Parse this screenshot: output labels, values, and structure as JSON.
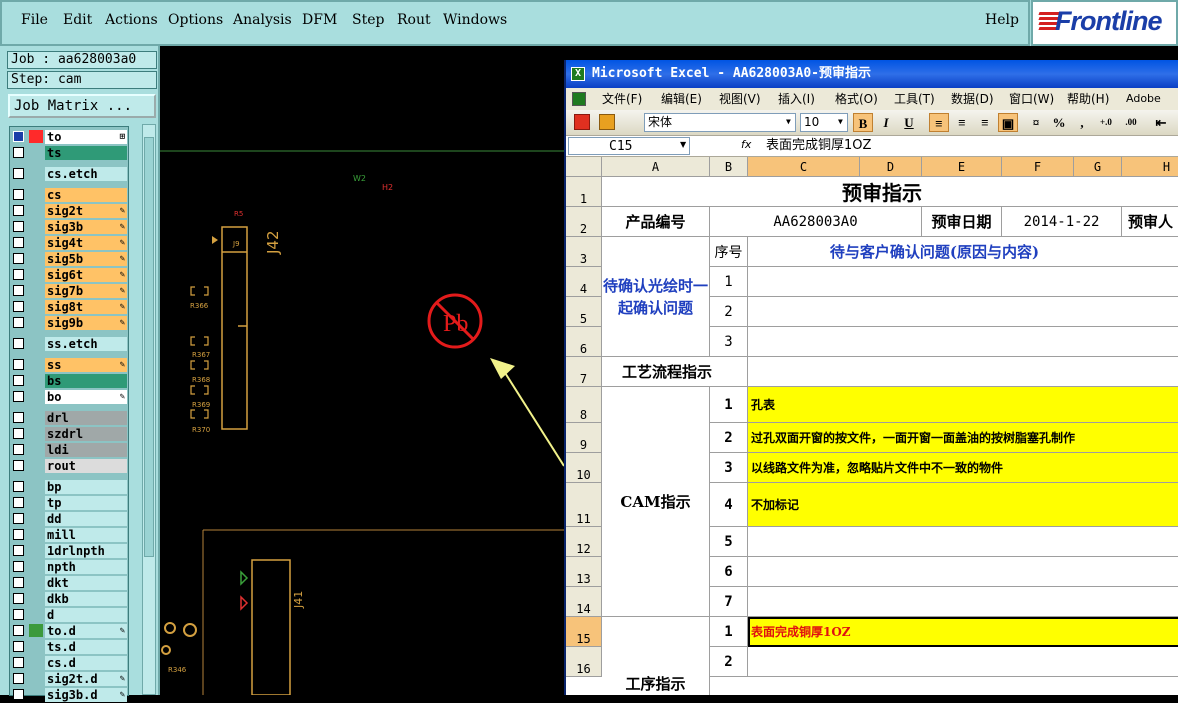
{
  "menubar": {
    "items": [
      "File",
      "Edit",
      "Actions",
      "Options",
      "Analysis",
      "DFM",
      "Step",
      "Rout",
      "Windows"
    ],
    "help": "Help",
    "logo": "Frontline"
  },
  "job": {
    "job_label": "Job : aa628003a0",
    "step_label": "Step: cam",
    "matrix_button": "Job Matrix ..."
  },
  "layers": [
    {
      "name": "to",
      "color": "#ffffff",
      "swatch": "#ff2a2a",
      "check": "blue",
      "icon": "⊞"
    },
    {
      "name": "ts",
      "color": "#2f9a77",
      "swatch": "",
      "check": "",
      "icon": ""
    },
    {
      "name": "cs.etch",
      "color": "#bfeaea",
      "swatch": "",
      "check": "",
      "icon": "",
      "gap": true
    },
    {
      "name": "cs",
      "color": "#ffc266",
      "swatch": "",
      "check": "",
      "icon": "",
      "gap": true
    },
    {
      "name": "sig2t",
      "color": "#ffc266",
      "swatch": "",
      "check": "",
      "icon": "✎"
    },
    {
      "name": "sig3b",
      "color": "#ffc266",
      "swatch": "",
      "check": "",
      "icon": "✎"
    },
    {
      "name": "sig4t",
      "color": "#ffc266",
      "swatch": "",
      "check": "",
      "icon": "✎"
    },
    {
      "name": "sig5b",
      "color": "#ffc266",
      "swatch": "",
      "check": "",
      "icon": "✎"
    },
    {
      "name": "sig6t",
      "color": "#ffc266",
      "swatch": "",
      "check": "",
      "icon": "✎"
    },
    {
      "name": "sig7b",
      "color": "#ffc266",
      "swatch": "",
      "check": "",
      "icon": "✎"
    },
    {
      "name": "sig8t",
      "color": "#ffc266",
      "swatch": "",
      "check": "",
      "icon": "✎"
    },
    {
      "name": "sig9b",
      "color": "#ffc266",
      "swatch": "",
      "check": "",
      "icon": "✎"
    },
    {
      "name": "ss.etch",
      "color": "#bfeaea",
      "swatch": "",
      "check": "",
      "icon": "",
      "gap": true
    },
    {
      "name": "ss",
      "color": "#ffc266",
      "swatch": "",
      "check": "",
      "icon": "✎",
      "gap": true
    },
    {
      "name": "bs",
      "color": "#2f9a77",
      "swatch": "",
      "check": "",
      "icon": ""
    },
    {
      "name": "bo",
      "color": "#ffffff",
      "swatch": "",
      "check": "",
      "icon": "✎"
    },
    {
      "name": "drl",
      "color": "#a0a8a8",
      "swatch": "",
      "check": "",
      "icon": "",
      "gap": true
    },
    {
      "name": "szdrl",
      "color": "#a0a8a8",
      "swatch": "",
      "check": "",
      "icon": ""
    },
    {
      "name": "ldi",
      "color": "#a0a8a8",
      "swatch": "",
      "check": "",
      "icon": ""
    },
    {
      "name": "rout",
      "color": "#dcdcdc",
      "swatch": "",
      "check": "",
      "icon": ""
    },
    {
      "name": "bp",
      "color": "#bfeaea",
      "swatch": "",
      "check": "",
      "icon": "",
      "gap": true
    },
    {
      "name": "tp",
      "color": "#bfeaea",
      "swatch": "",
      "check": "",
      "icon": ""
    },
    {
      "name": "dd",
      "color": "#bfeaea",
      "swatch": "",
      "check": "",
      "icon": ""
    },
    {
      "name": "mill",
      "color": "#bfeaea",
      "swatch": "",
      "check": "",
      "icon": ""
    },
    {
      "name": "1drlnpth",
      "color": "#bfeaea",
      "swatch": "",
      "check": "",
      "icon": ""
    },
    {
      "name": "npth",
      "color": "#bfeaea",
      "swatch": "",
      "check": "",
      "icon": ""
    },
    {
      "name": "dkt",
      "color": "#bfeaea",
      "swatch": "",
      "check": "",
      "icon": ""
    },
    {
      "name": "dkb",
      "color": "#bfeaea",
      "swatch": "",
      "check": "",
      "icon": ""
    },
    {
      "name": "d",
      "color": "#bfeaea",
      "swatch": "",
      "check": "",
      "icon": ""
    },
    {
      "name": "to.d",
      "color": "#bfeaea",
      "swatch": "#3c9a3c",
      "check": "",
      "icon": "✎"
    },
    {
      "name": "ts.d",
      "color": "#bfeaea",
      "swatch": "",
      "check": "",
      "icon": ""
    },
    {
      "name": "cs.d",
      "color": "#bfeaea",
      "swatch": "",
      "check": "",
      "icon": ""
    },
    {
      "name": "sig2t.d",
      "color": "#bfeaea",
      "swatch": "",
      "check": "",
      "icon": "✎"
    },
    {
      "name": "sig3b.d",
      "color": "#bfeaea",
      "swatch": "",
      "check": "",
      "icon": "✎"
    }
  ],
  "cad": {
    "labels": {
      "j42": "J42",
      "j41": "J41",
      "w2": "W2",
      "h2": "H2",
      "r366": "R366",
      "r367": "R367",
      "r368": "R368",
      "r369": "R369",
      "r370": "R370",
      "r5": "R5",
      "j": "J9"
    },
    "pb_symbol": "Pb"
  },
  "excel": {
    "title": "Microsoft Excel - AA628003A0-预审指示",
    "menu": [
      "文件(F)",
      "编辑(E)",
      "视图(V)",
      "插入(I)",
      "格式(O)",
      "工具(T)",
      "数据(D)",
      "窗口(W)",
      "帮助(H)",
      "Adobe PDF"
    ],
    "font_name": "宋体",
    "font_size": "10",
    "toolbar": {
      "bold": "B",
      "italic": "I",
      "underline": "U",
      "percent": "%",
      "comma": ","
    },
    "name_box": "C15",
    "fx": "fx",
    "formula": "表面完成铜厚1OZ",
    "columns": [
      "A",
      "B",
      "C",
      "D",
      "E",
      "F",
      "G",
      "H"
    ],
    "rows": [
      "1",
      "2",
      "3",
      "4",
      "5",
      "6",
      "7",
      "8",
      "9",
      "10",
      "11",
      "12",
      "13",
      "14",
      "15",
      "16"
    ],
    "cells": {
      "title": "预审指示",
      "r2a": "产品编号",
      "r2c": "AA628003A0",
      "r2e": "预审日期",
      "r2f": "2014-1-22",
      "r2h": "预审人",
      "r3b": "序号",
      "r3c": "待与客户确认问题(原因与内容)",
      "a46": "待确认光绘时一起确认问题",
      "b4": "1",
      "b5": "2",
      "b6": "3",
      "a7": "工艺流程指示",
      "a_cam": "CAM指示",
      "b8": "1",
      "c8": "孔表",
      "b9": "2",
      "c9": "过孔双面开窗的按文件，一面开窗一面盖油的按树脂塞孔制作",
      "b10": "3",
      "c10": "以线路文件为准，忽略贴片文件中不一致的物件",
      "b11": "4",
      "c11": "不加标记",
      "b12": "5",
      "b13": "6",
      "b14": "7",
      "b15": "1",
      "c15": "表面完成铜厚1OZ",
      "b16": "2",
      "a_bottom": "工序指示"
    }
  }
}
